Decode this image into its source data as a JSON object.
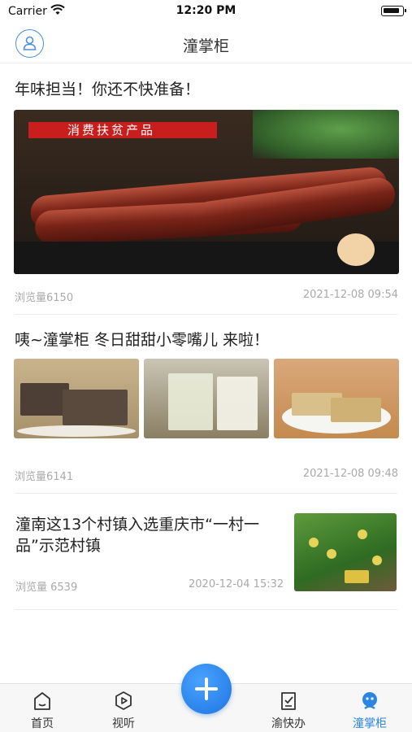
{
  "status_bar": {
    "carrier": "Carrier",
    "time": "12:20 PM"
  },
  "header": {
    "title": "潼掌柜",
    "avatar_icon": "user-icon"
  },
  "articles": [
    {
      "title": "年味担当！你还不快准备！",
      "image_banner": "消费扶贫产品",
      "views": "浏览量6150",
      "date": "2021-12-08 09:54"
    },
    {
      "title": "咦~潼掌柜 冬日甜甜小零嘴儿 来啦！",
      "views": "浏览量6141",
      "date": "2021-12-08 09:48"
    },
    {
      "title": "潼南这13个村镇入选重庆市“一村一品”示范村镇",
      "views": "浏览量 6539",
      "date": "2020-12-04 15:32"
    }
  ],
  "tabs": [
    {
      "label": "首页",
      "icon": "home-icon"
    },
    {
      "label": "视听",
      "icon": "play-icon"
    },
    {
      "label": "渝快办",
      "icon": "checklist-icon"
    },
    {
      "label": "潼掌柜",
      "icon": "shopkeeper-icon",
      "active": true
    }
  ],
  "fab_icon": "plus-icon",
  "colors": {
    "accent": "#2a86e0",
    "banner_red": "#c81e1e"
  }
}
